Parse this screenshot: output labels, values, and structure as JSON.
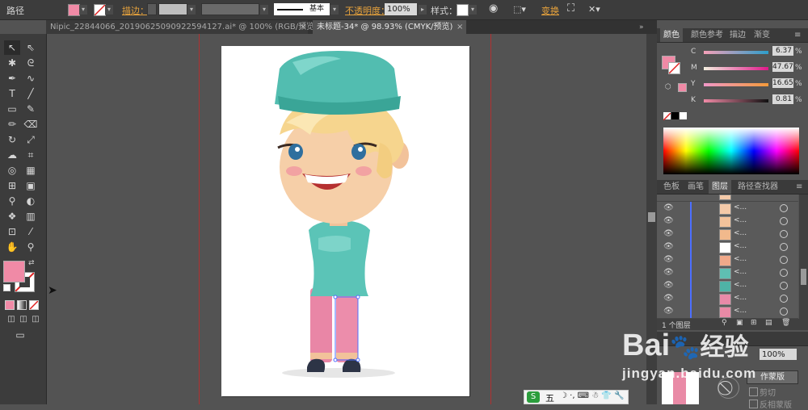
{
  "control_bar": {
    "object_type": "路径",
    "stroke_label": "描边：",
    "stroke_profile": "基本",
    "opacity_label": "不透明度：",
    "opacity_value": "100%",
    "style_label": "样式：",
    "transform_label": "变换",
    "fill_color": "#f08aa6"
  },
  "tabs": [
    {
      "label": "Nipic_22844066_20190625090922594127.ai* @ 100% (RGB/预览)",
      "close": "×"
    },
    {
      "label": "未标题-34* @ 98.93% (CMYK/预览)",
      "close": "×"
    }
  ],
  "toolbox": {
    "fill_color": "#f08aa6",
    "stroke_color": "none"
  },
  "color_panel": {
    "tabs": [
      "颜色",
      "颜色参考",
      "描边",
      "渐变"
    ],
    "channels": [
      {
        "label": "C",
        "value": "6.37",
        "unit": "%"
      },
      {
        "label": "M",
        "value": "47.67",
        "unit": "%"
      },
      {
        "label": "Y",
        "value": "16.65",
        "unit": "%"
      },
      {
        "label": "K",
        "value": "0.81",
        "unit": "%"
      }
    ]
  },
  "layers_panel": {
    "tabs": [
      "色板",
      "画笔",
      "图层",
      "路径查找器"
    ],
    "row_name": "<...",
    "layer_count": "1 个图层",
    "rows": [
      {
        "thumb": "#f4c9a8"
      },
      {
        "thumb": "#f3c29b"
      },
      {
        "thumb": "#f1b98c"
      },
      {
        "thumb": "#ffffff"
      },
      {
        "thumb": "#f0a98a"
      },
      {
        "thumb": "#5fbfb2"
      },
      {
        "thumb": "#4fb3a6"
      },
      {
        "thumb": "#e88aa8"
      },
      {
        "thumb": "#e98aa6"
      }
    ]
  },
  "transparency_panel": {
    "opacity_value": "100%",
    "make_mask": "作蒙版",
    "clip": "剪切",
    "invert_mask": "反相蒙版"
  },
  "watermark": {
    "brand": "Bai",
    "brand2": "经验",
    "url": "jingyan.baidu.com"
  },
  "ime_bar": {
    "label": "五"
  }
}
